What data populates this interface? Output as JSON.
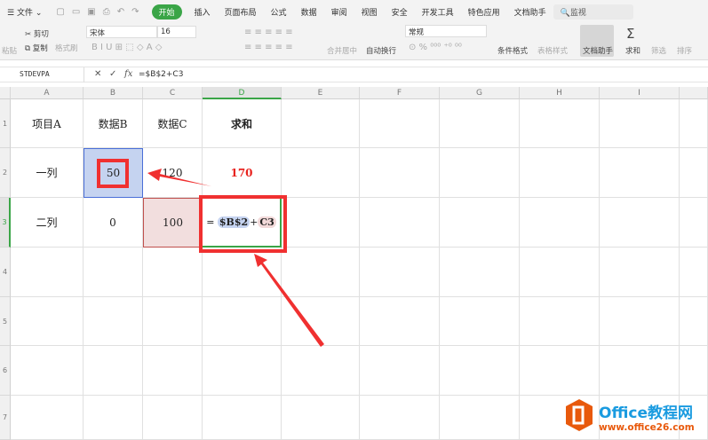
{
  "menu": {
    "file": "文件",
    "tabs": [
      "开始",
      "插入",
      "页面布局",
      "公式",
      "数据",
      "审阅",
      "视图",
      "安全",
      "开发工具",
      "特色应用",
      "文档助手"
    ],
    "search": "监视"
  },
  "ribbon": {
    "paste": "粘贴",
    "cut": "剪切",
    "copy": "复制",
    "format_painter": "格式刷",
    "font": "宋体",
    "size": "16",
    "merge": "合并居中",
    "wrap": "自动换行",
    "number_format": "常规",
    "conditional": "条件格式",
    "table_style": "表格样式",
    "doc_helper": "文档助手",
    "sum": "求和",
    "filter": "筛选",
    "sort": "排序"
  },
  "formula_bar": {
    "name_box": "STDEVPA",
    "fx": "fx",
    "formula": "=$B$2+C3"
  },
  "columns": [
    "A",
    "B",
    "C",
    "D",
    "E",
    "F",
    "G",
    "H",
    "I"
  ],
  "rows": [
    "1",
    "2",
    "3",
    "4",
    "5",
    "6",
    "7"
  ],
  "cells": {
    "A1": "项目A",
    "B1": "数据B",
    "C1": "数据C",
    "D1": "求和",
    "A2": "一列",
    "B2": "50",
    "C2": "120",
    "D2": "170",
    "A3": "二列",
    "B3": "0",
    "C3": "100"
  },
  "edit": {
    "eq": "=",
    "ref1": "$B$2",
    "plus": "+",
    "ref2": "C3"
  },
  "watermark": {
    "title": "Office教程网",
    "url": "www.office26.com"
  },
  "colors": {
    "accent": "#3aa547",
    "highlight": "#e8231f",
    "ref1": "#c5d3f0",
    "ref2": "#f2d9d9"
  }
}
